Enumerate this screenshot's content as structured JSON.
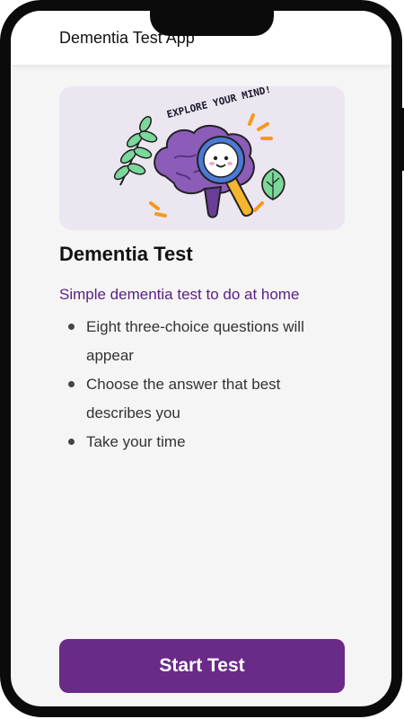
{
  "app": {
    "title": "Dementia Test App"
  },
  "hero": {
    "badge_text": "EXPLORE YOUR MIND!"
  },
  "content": {
    "title": "Dementia Test",
    "subtitle": "Simple dementia test to do at home",
    "bullets": [
      "Eight three-choice questions will appear",
      "Choose the answer that best describes you",
      "Take your time"
    ]
  },
  "actions": {
    "start_label": "Start Test"
  },
  "colors": {
    "accent": "#6a2a87",
    "subtitle": "#5b1e83",
    "hero_bg": "#ece6f1"
  }
}
